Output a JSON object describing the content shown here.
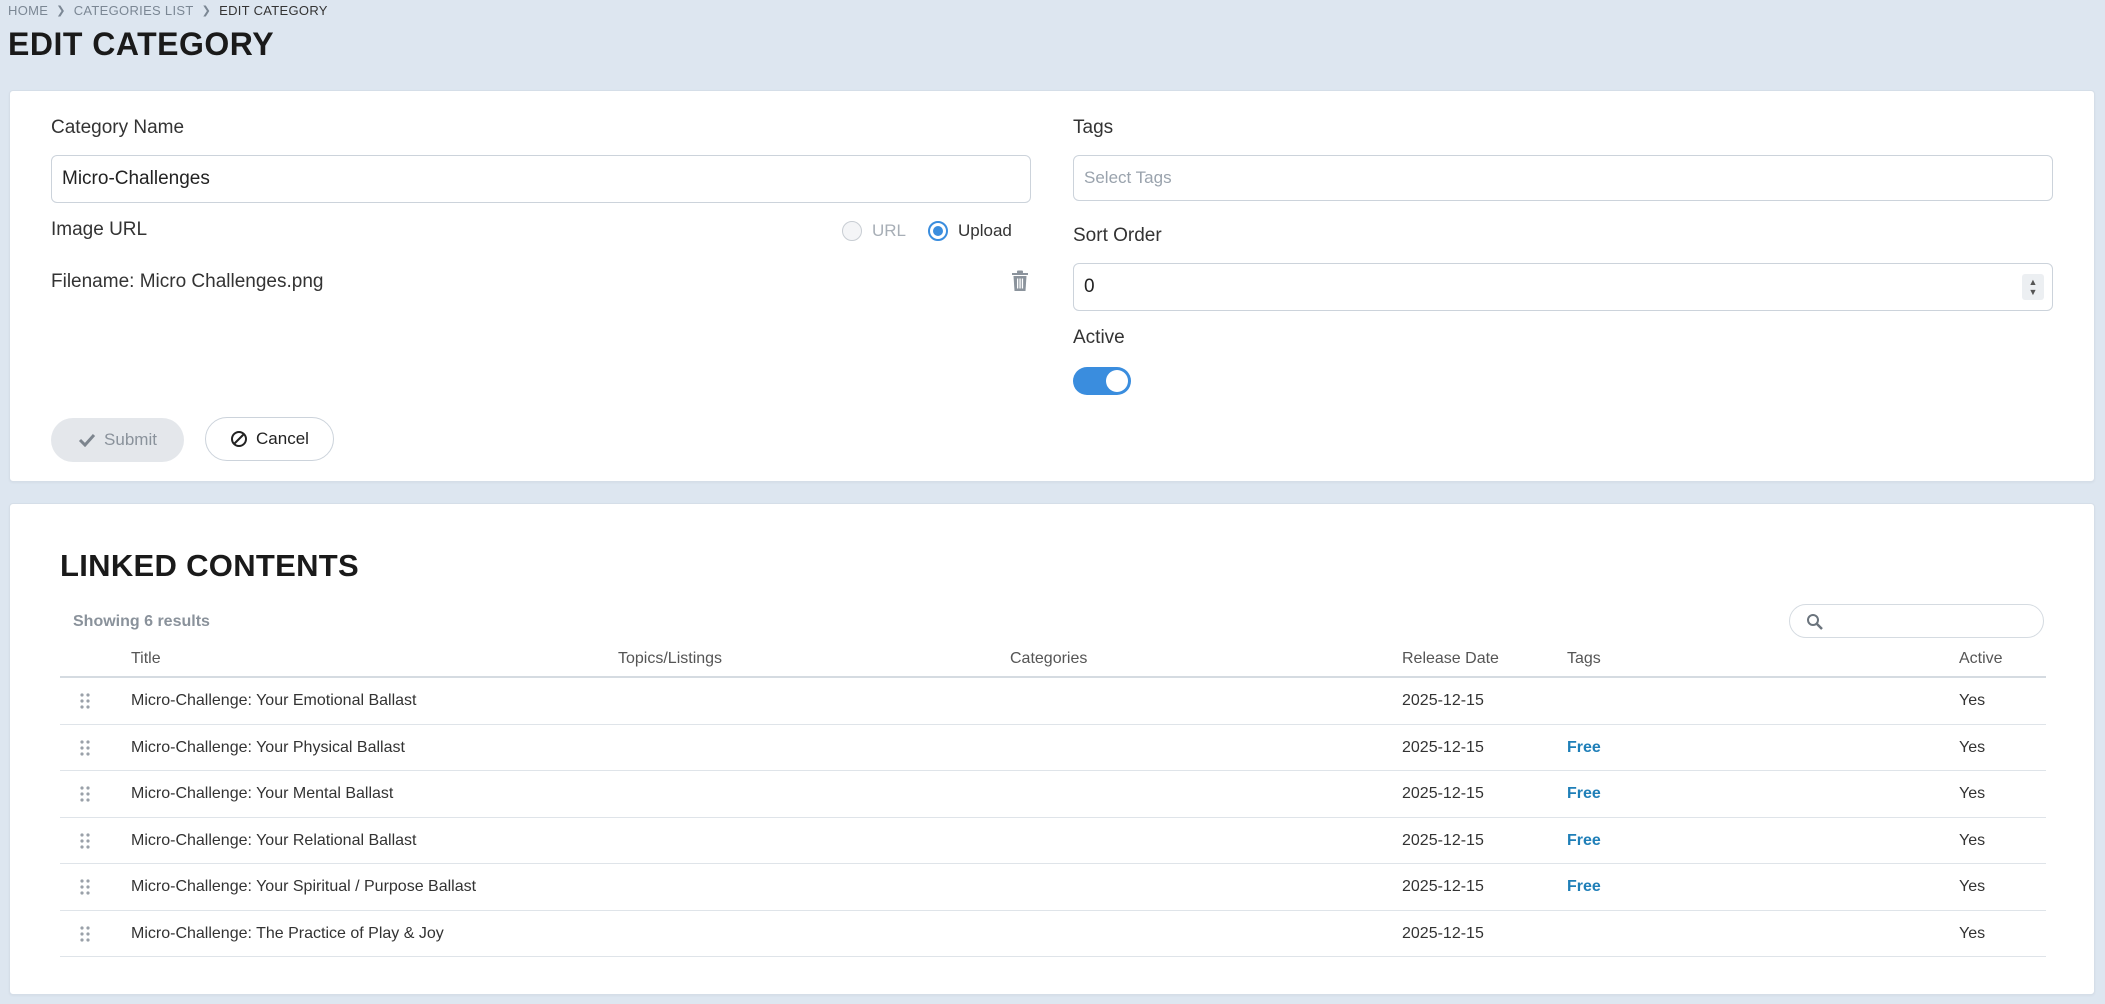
{
  "breadcrumb": {
    "home": "HOME",
    "list": "CATEGORIES LIST",
    "current": "EDIT CATEGORY"
  },
  "page_title": "EDIT CATEGORY",
  "form": {
    "category_name_label": "Category Name",
    "category_name_value": "Micro-Challenges",
    "image_url_label": "Image URL",
    "radio_url_label": "URL",
    "radio_upload_label": "Upload",
    "image_source_selected": "Upload",
    "filename_text": "Filename: Micro Challenges.png",
    "tags_label": "Tags",
    "tags_placeholder": "Select Tags",
    "sort_order_label": "Sort Order",
    "sort_order_value": "0",
    "active_label": "Active",
    "active_on": true,
    "submit_label": "Submit",
    "cancel_label": "Cancel"
  },
  "linked": {
    "title": "LINKED CONTENTS",
    "results_text": "Showing 6 results",
    "columns": {
      "title": "Title",
      "topics": "Topics/Listings",
      "categories": "Categories",
      "release_date": "Release Date",
      "tags": "Tags",
      "active": "Active"
    },
    "rows": [
      {
        "title": "Micro-Challenge: Your Emotional Ballast",
        "topics": "",
        "categories": "",
        "release_date": "2025-12-15",
        "tags": "",
        "active": "Yes"
      },
      {
        "title": "Micro-Challenge: Your Physical Ballast",
        "topics": "",
        "categories": "",
        "release_date": "2025-12-15",
        "tags": "Free",
        "active": "Yes"
      },
      {
        "title": "Micro-Challenge: Your Mental Ballast",
        "topics": "",
        "categories": "",
        "release_date": "2025-12-15",
        "tags": "Free",
        "active": "Yes"
      },
      {
        "title": "Micro-Challenge: Your Relational Ballast",
        "topics": "",
        "categories": "",
        "release_date": "2025-12-15",
        "tags": "Free",
        "active": "Yes"
      },
      {
        "title": "Micro-Challenge: Your Spiritual / Purpose Ballast",
        "topics": "",
        "categories": "",
        "release_date": "2025-12-15",
        "tags": "Free",
        "active": "Yes"
      },
      {
        "title": "Micro-Challenge: The Practice of Play & Joy",
        "topics": "",
        "categories": "",
        "release_date": "2025-12-15",
        "tags": "",
        "active": "Yes"
      }
    ]
  },
  "colors": {
    "accent": "#3a8dde",
    "tag_free": "#1f7fb8",
    "page_bg": "#dde6f0"
  },
  "icons": {
    "breadcrumb_separator": "chevron-right-icon",
    "delete": "trash-icon",
    "submit": "check-icon",
    "cancel": "ban-icon",
    "search": "search-icon",
    "row_handle": "drag-handle-icon"
  }
}
